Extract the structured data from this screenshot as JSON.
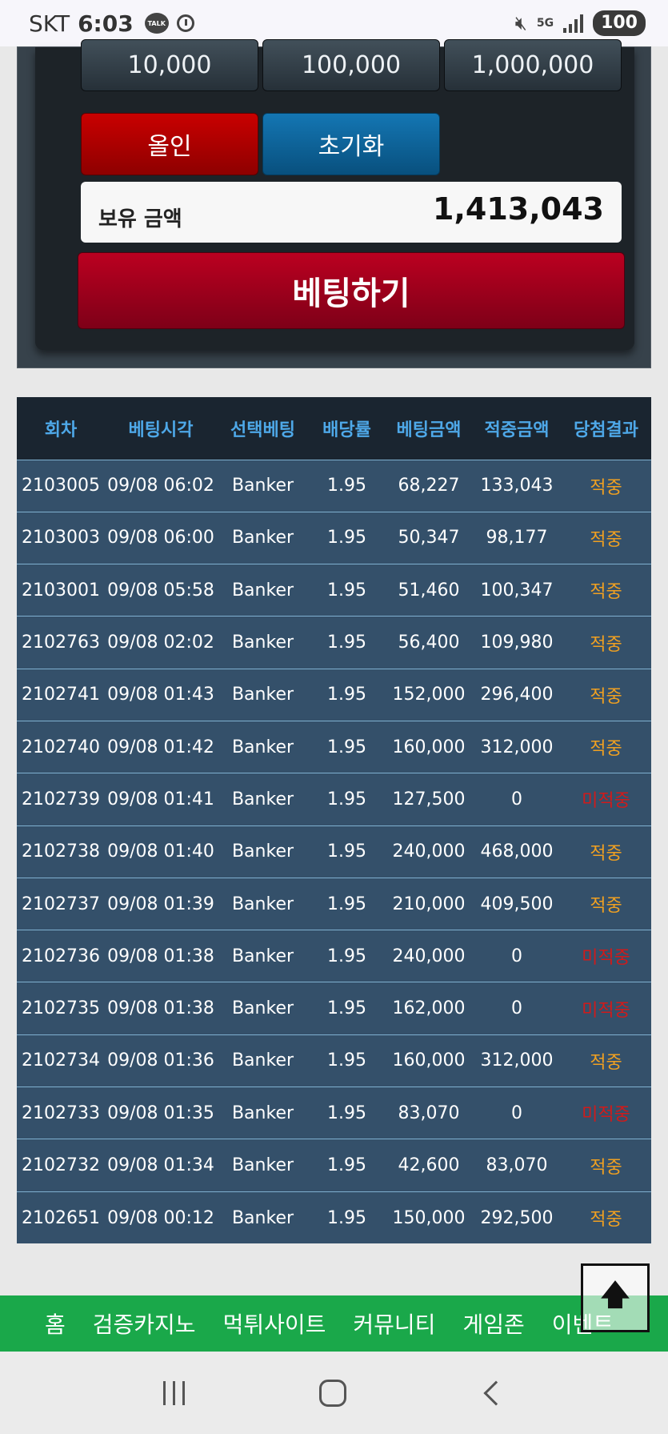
{
  "status_bar": {
    "carrier": "SKT",
    "time": "6:03",
    "talk_label": "TALK",
    "network": "5G",
    "battery": "100"
  },
  "bet_panel": {
    "chips": [
      "10,000",
      "100,000",
      "1,000,000"
    ],
    "allin_label": "올인",
    "reset_label": "초기화",
    "balance_label": "보유 금액",
    "balance_value": "1,413,043",
    "submit_label": "베팅하기"
  },
  "history": {
    "headers": [
      "회차",
      "베팅시각",
      "선택베팅",
      "배당률",
      "베팅금액",
      "적중금액",
      "당첨결과"
    ],
    "rows": [
      {
        "round": "2103005",
        "time": "09/08 06:02",
        "pick": "Banker",
        "odds": "1.95",
        "bet": "68,227",
        "win": "133,043",
        "result": "적중",
        "hit": true
      },
      {
        "round": "2103003",
        "time": "09/08 06:00",
        "pick": "Banker",
        "odds": "1.95",
        "bet": "50,347",
        "win": "98,177",
        "result": "적중",
        "hit": true
      },
      {
        "round": "2103001",
        "time": "09/08 05:58",
        "pick": "Banker",
        "odds": "1.95",
        "bet": "51,460",
        "win": "100,347",
        "result": "적중",
        "hit": true
      },
      {
        "round": "2102763",
        "time": "09/08 02:02",
        "pick": "Banker",
        "odds": "1.95",
        "bet": "56,400",
        "win": "109,980",
        "result": "적중",
        "hit": true
      },
      {
        "round": "2102741",
        "time": "09/08 01:43",
        "pick": "Banker",
        "odds": "1.95",
        "bet": "152,000",
        "win": "296,400",
        "result": "적중",
        "hit": true
      },
      {
        "round": "2102740",
        "time": "09/08 01:42",
        "pick": "Banker",
        "odds": "1.95",
        "bet": "160,000",
        "win": "312,000",
        "result": "적중",
        "hit": true
      },
      {
        "round": "2102739",
        "time": "09/08 01:41",
        "pick": "Banker",
        "odds": "1.95",
        "bet": "127,500",
        "win": "0",
        "result": "미적중",
        "hit": false
      },
      {
        "round": "2102738",
        "time": "09/08 01:40",
        "pick": "Banker",
        "odds": "1.95",
        "bet": "240,000",
        "win": "468,000",
        "result": "적중",
        "hit": true
      },
      {
        "round": "2102737",
        "time": "09/08 01:39",
        "pick": "Banker",
        "odds": "1.95",
        "bet": "210,000",
        "win": "409,500",
        "result": "적중",
        "hit": true
      },
      {
        "round": "2102736",
        "time": "09/08 01:38",
        "pick": "Banker",
        "odds": "1.95",
        "bet": "240,000",
        "win": "0",
        "result": "미적중",
        "hit": false
      },
      {
        "round": "2102735",
        "time": "09/08 01:38",
        "pick": "Banker",
        "odds": "1.95",
        "bet": "162,000",
        "win": "0",
        "result": "미적중",
        "hit": false
      },
      {
        "round": "2102734",
        "time": "09/08 01:36",
        "pick": "Banker",
        "odds": "1.95",
        "bet": "160,000",
        "win": "312,000",
        "result": "적중",
        "hit": true
      },
      {
        "round": "2102733",
        "time": "09/08 01:35",
        "pick": "Banker",
        "odds": "1.95",
        "bet": "83,070",
        "win": "0",
        "result": "미적중",
        "hit": false
      },
      {
        "round": "2102732",
        "time": "09/08 01:34",
        "pick": "Banker",
        "odds": "1.95",
        "bet": "42,600",
        "win": "83,070",
        "result": "적중",
        "hit": true
      },
      {
        "round": "2102651",
        "time": "09/08 00:12",
        "pick": "Banker",
        "odds": "1.95",
        "bet": "150,000",
        "win": "292,500",
        "result": "적중",
        "hit": true
      }
    ]
  },
  "site_nav": {
    "items": [
      "홈",
      "검증카지노",
      "먹튀사이트",
      "커뮤니티",
      "게임존",
      "이벤트"
    ]
  },
  "top_button": {
    "icon": "arrow-up-icon",
    "glyph": "🡅"
  },
  "colors": {
    "hit": "#f0a021",
    "miss": "#d11a1a",
    "header_text": "#4ea8e8",
    "nav_green": "#1aa84a",
    "submit_red": "#bb0020"
  }
}
